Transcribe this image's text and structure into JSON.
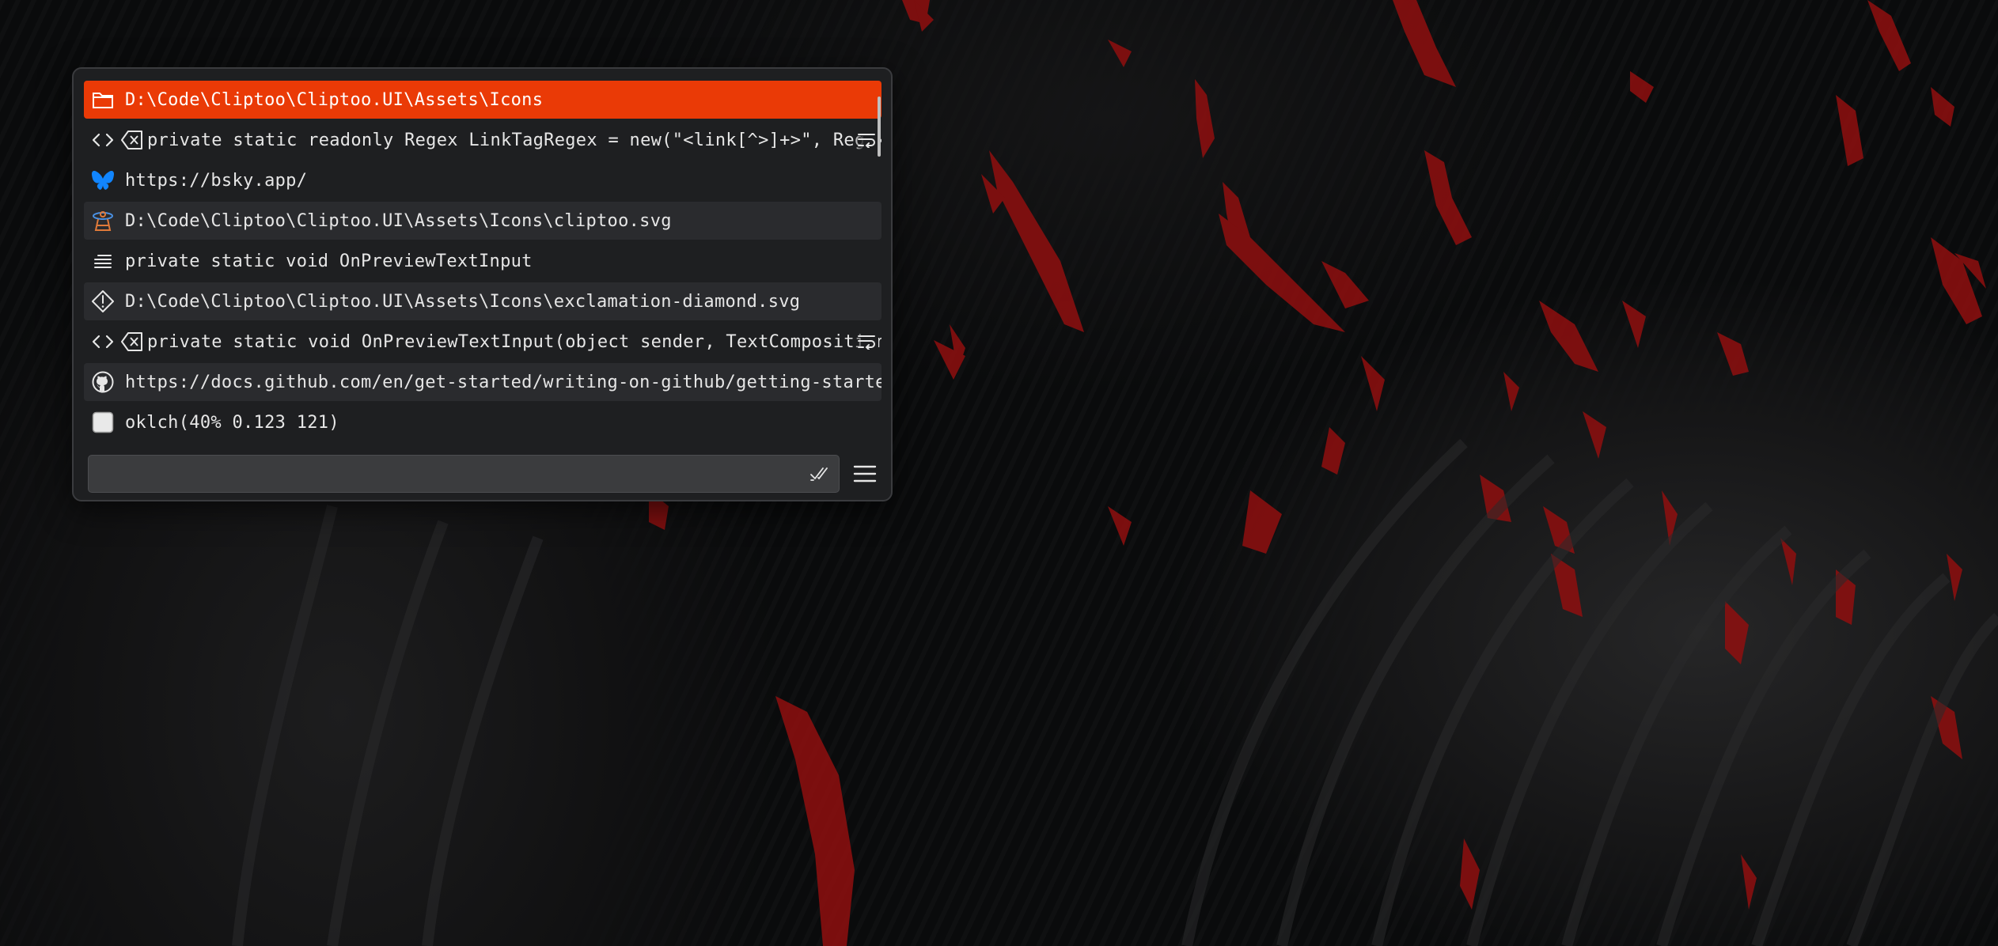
{
  "colors": {
    "accent": "#ea3a06",
    "popup_background": "#1e1f21",
    "row_alt_background": "#2a2b2e",
    "search_background": "#3b3c3e",
    "bluesky_blue": "#1185fe"
  },
  "clips": [
    {
      "icon": "folder-icon",
      "text": "D:\\Code\\Cliptoo\\Cliptoo.UI\\Assets\\Icons",
      "state": "selected"
    },
    {
      "icon": "code-icon",
      "text": "private static readonly Regex LinkTagRegex = new(\"<link[^>]+>\", RegexOptions.Compiled | RegexOptions.IgnoreCase);",
      "state": "normal"
    },
    {
      "icon": "bluesky-butterfly-icon",
      "text": "https://bsky.app/",
      "state": "normal"
    },
    {
      "icon": "cliptoo-svg-file-icon",
      "text": "D:\\Code\\Cliptoo\\Cliptoo.UI\\Assets\\Icons\\cliptoo.svg",
      "state": "alt"
    },
    {
      "icon": "text-lines-icon",
      "text": "private static void OnPreviewTextInput",
      "state": "normal"
    },
    {
      "icon": "exclamation-diamond-icon",
      "text": "D:\\Code\\Cliptoo\\Cliptoo.UI\\Assets\\Icons\\exclamation-diamond.svg",
      "state": "alt"
    },
    {
      "icon": "code-icon",
      "text": "private static void OnPreviewTextInput(object sender, TextCompositionEventArgs e)",
      "state": "normal"
    },
    {
      "icon": "github-icon",
      "text": "https://docs.github.com/en/get-started/writing-on-github/getting-started-with-writing-and-formatting-on-github",
      "state": "alt"
    },
    {
      "icon": "color-swatch-icon",
      "text": "oklch(40% 0.123 121)",
      "state": "normal"
    }
  ],
  "search": {
    "value": "",
    "placeholder": ""
  },
  "icons": {
    "clear_whitespace": "clear-whitespace-icon",
    "wrap": "word-wrap-icon",
    "mark_read": "double-check-icon",
    "menu": "hamburger-menu-icon"
  }
}
